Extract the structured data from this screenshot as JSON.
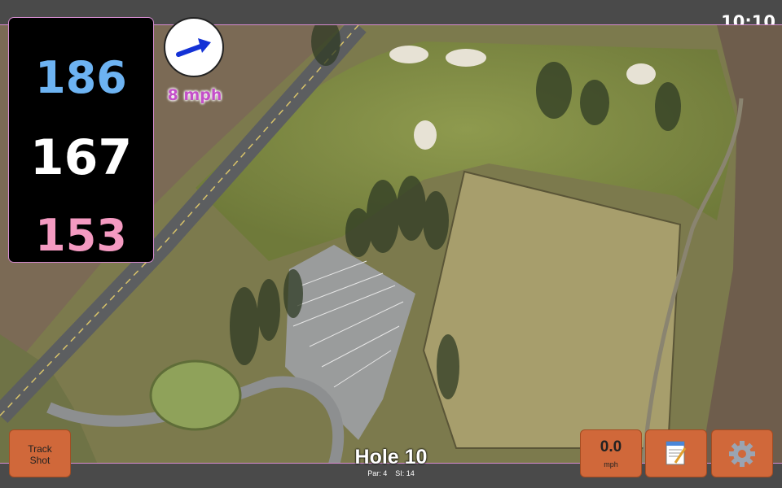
{
  "status": {
    "time": "10:10"
  },
  "yardages": {
    "back": "186",
    "middle": "167",
    "front": "153"
  },
  "wind": {
    "speed_label": "8 mph",
    "icon": "wind-arrow-icon"
  },
  "hole": {
    "title": "Hole 10",
    "par": "Par: 4",
    "stroke_index": "SI: 14"
  },
  "buttons": {
    "track_shot": [
      "Track",
      "Shot"
    ],
    "speed_value": "0.0",
    "speed_unit": "mph",
    "notes_icon": "notepad-icon",
    "settings_icon": "gear-icon"
  },
  "colors": {
    "back_yardage": "#6db3f2",
    "middle_yardage": "#ffffff",
    "front_yardage": "#f49ac1",
    "button": "#d0683a",
    "wind_label": "#c44fc9"
  }
}
